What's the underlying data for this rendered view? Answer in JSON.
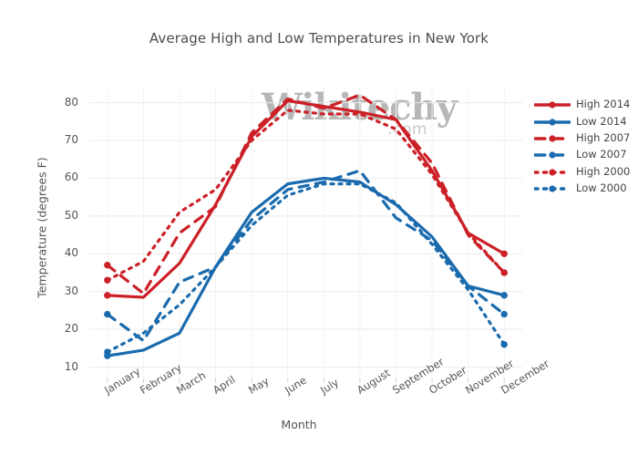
{
  "chart_data": {
    "type": "line",
    "title": "Average High and Low Temperatures in New York",
    "xlabel": "Month",
    "ylabel": "Temperature (degrees F)",
    "categories": [
      "January",
      "February",
      "March",
      "April",
      "May",
      "June",
      "July",
      "August",
      "September",
      "October",
      "November",
      "December"
    ],
    "yticks": [
      10,
      20,
      30,
      40,
      50,
      60,
      70,
      80
    ],
    "ylim": [
      7,
      84
    ],
    "grid": true,
    "legend_position": "right",
    "watermark": {
      "main": "Wikitechy",
      "sub": ".com"
    },
    "colors": {
      "red": "#CC2027",
      "blue": "#1A6BAE"
    },
    "series": [
      {
        "name": "High 2014",
        "color": "#CC2027",
        "dash": "solid",
        "values": [
          29,
          28.5,
          37.5,
          53,
          71,
          80.5,
          79,
          77.5,
          75.5,
          62,
          45.5,
          40
        ]
      },
      {
        "name": "Low 2014",
        "color": "#1A6BAE",
        "dash": "solid",
        "values": [
          13,
          14.5,
          19,
          36.5,
          51,
          58.5,
          60,
          59,
          53,
          44.5,
          31.5,
          29
        ]
      },
      {
        "name": "High 2007",
        "color": "#CC2027",
        "dash": "dashed",
        "values": [
          37,
          29.5,
          45.5,
          52.5,
          72,
          81,
          78.5,
          82,
          75.5,
          64,
          45,
          35
        ]
      },
      {
        "name": "Low 2007",
        "color": "#1A6BAE",
        "dash": "dashed",
        "values": [
          24,
          17,
          32.5,
          36.5,
          49,
          57,
          59,
          62,
          49.5,
          43.5,
          31.5,
          24
        ]
      },
      {
        "name": "High 2000",
        "color": "#CC2027",
        "dash": "dotted",
        "values": [
          33,
          38,
          51,
          57,
          70,
          78,
          77,
          77,
          73,
          61,
          45.5,
          35
        ]
      },
      {
        "name": "Low 2000",
        "color": "#1A6BAE",
        "dash": "dotted",
        "values": [
          14,
          19,
          26.5,
          36.5,
          47.5,
          55.5,
          58.5,
          58.5,
          53.5,
          42.5,
          30.5,
          16
        ]
      }
    ]
  },
  "legend": {
    "items": [
      {
        "label": "High 2014"
      },
      {
        "label": "Low 2014"
      },
      {
        "label": "High 2007"
      },
      {
        "label": "Low 2007"
      },
      {
        "label": "High 2000"
      },
      {
        "label": "Low 2000"
      }
    ]
  }
}
